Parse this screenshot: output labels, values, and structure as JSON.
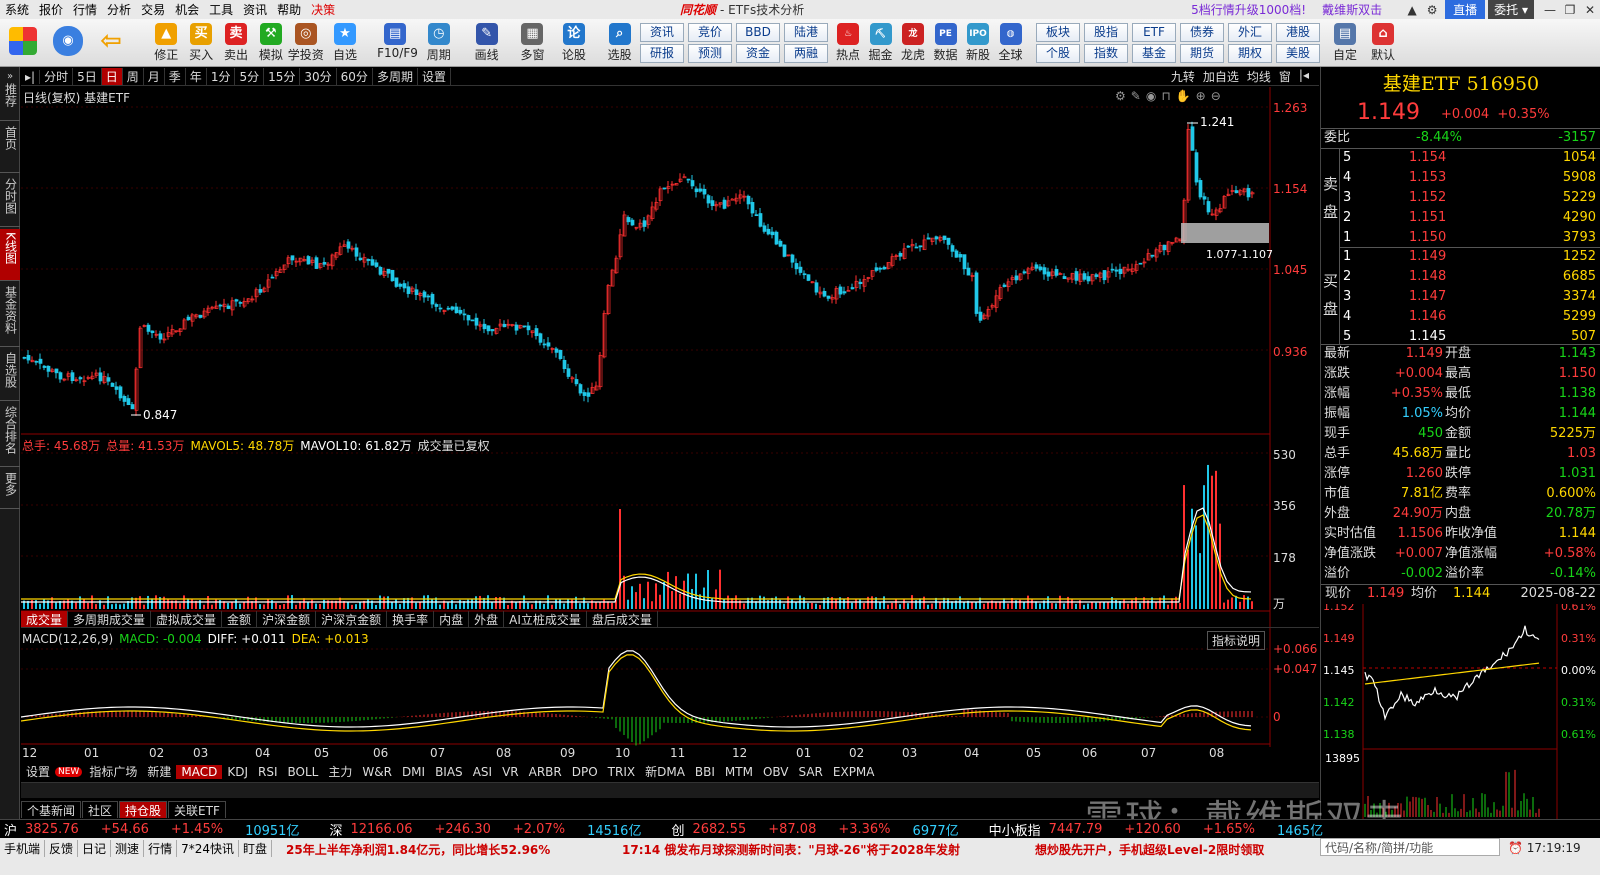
{
  "menubar": {
    "items": [
      "系统",
      "报价",
      "行情",
      "分析",
      "交易",
      "机会",
      "工具",
      "资讯",
      "帮助"
    ],
    "highlight": "决策",
    "logo": "同花顺",
    "title": "- ETFs技术分析",
    "promo": "5档行情升级1000档!",
    "user": "戴维斯双击",
    "btn_live": "直播",
    "btn_entrust": "委托"
  },
  "toolbar": {
    "buttons": [
      {
        "label": "修正",
        "icon": "up-arrow-icon"
      },
      {
        "label": "买入",
        "icon": "buy-icon"
      },
      {
        "label": "卖出",
        "icon": "sell-icon"
      },
      {
        "label": "模拟",
        "icon": "hammer-icon"
      },
      {
        "label": "学投资",
        "icon": "graduation-icon"
      },
      {
        "label": "自选",
        "icon": "star-icon"
      },
      {
        "label": "F10/F9",
        "icon": "document-icon"
      },
      {
        "label": "周期",
        "icon": "clock-icon"
      },
      {
        "label": "画线",
        "icon": "pen-icon"
      },
      {
        "label": "多窗",
        "icon": "grid-icon"
      },
      {
        "label": "论股",
        "icon": "discuss-icon"
      },
      {
        "label": "选股",
        "icon": "search-icon"
      }
    ],
    "grid1": [
      "资讯",
      "竞价",
      "BBD",
      "陆港"
    ],
    "grid2": [
      "研报",
      "预测",
      "资金",
      "两融"
    ],
    "buttons2": [
      {
        "label": "热点",
        "icon": "hot-icon"
      },
      {
        "label": "掘金",
        "icon": "dig-icon"
      },
      {
        "label": "龙虎",
        "icon": "dragon-icon"
      },
      {
        "label": "数据",
        "icon": "data-icon"
      },
      {
        "label": "新股",
        "icon": "ipo-icon"
      },
      {
        "label": "全球",
        "icon": "globe-icon"
      }
    ],
    "grid3": [
      "板块",
      "股指",
      "ETF",
      "债券",
      "外汇",
      "港股"
    ],
    "grid4": [
      "个股",
      "指数",
      "基金",
      "期货",
      "期权",
      "美股"
    ],
    "buttons3": [
      {
        "label": "自定",
        "icon": "custom-icon"
      },
      {
        "label": "默认",
        "icon": "home-icon"
      }
    ]
  },
  "leftbar": [
    "推荐",
    "首页",
    "分时图",
    "K线图",
    "基金资料",
    "自选股",
    "综合排名",
    "更多"
  ],
  "periods": {
    "items": [
      "分时",
      "5日",
      "日",
      "周",
      "月",
      "季",
      "年",
      "1分",
      "5分",
      "15分",
      "30分",
      "60分",
      "多周期",
      "设置"
    ],
    "active": "日",
    "right": [
      "九转",
      "加自选",
      "均线",
      "窗"
    ]
  },
  "kchart": {
    "title": "日线(复权) 基建ETF",
    "ticks": [
      "1.263",
      "1.154",
      "1.045",
      "0.936"
    ],
    "high_label": "1.241",
    "low_label": "0.847",
    "range_label": "1.077-1.107"
  },
  "volume": {
    "legend": [
      {
        "text": "总手: 45.68万",
        "color": "#ff3c3c"
      },
      {
        "text": "总量: 41.53万",
        "color": "#ff3c3c"
      },
      {
        "text": "MAVOL5: 48.78万",
        "color": "#ffd700"
      },
      {
        "text": "MAVOL10: 61.82万",
        "color": "#ffffff"
      },
      {
        "text": "成交量已复权",
        "color": "#dddddd"
      }
    ],
    "ticks": [
      "530",
      "356",
      "178"
    ],
    "unit": "万"
  },
  "subtabs": [
    "成交量",
    "多周期成交量",
    "虚拟成交量",
    "金额",
    "沪深金额",
    "沪深京金额",
    "换手率",
    "内盘",
    "外盘",
    "AI立桩成交量",
    "盘后成交量"
  ],
  "macd": {
    "legend": [
      {
        "text": "MACD(12,26,9)",
        "color": "#dddddd"
      },
      {
        "text": "MACD: -0.004",
        "color": "#18d418"
      },
      {
        "text": "DIFF: +0.011",
        "color": "#ffffff"
      },
      {
        "text": "DEA: +0.013",
        "color": "#ffd700"
      }
    ],
    "explain": "指标说明",
    "ticks": [
      "+0.066",
      "+0.047",
      "0"
    ]
  },
  "months": [
    "12",
    "01",
    "02",
    "03",
    "04",
    "05",
    "06",
    "07",
    "08",
    "09",
    "10",
    "11",
    "12",
    "01",
    "02",
    "03",
    "04",
    "05",
    "06",
    "07",
    "08"
  ],
  "indtabs": {
    "settings": "设置",
    "new": "NEW",
    "square": "指标广场",
    "create": "新建",
    "items": [
      "MACD",
      "KDJ",
      "RSI",
      "BOLL",
      "主力",
      "W&R",
      "DMI",
      "BIAS",
      "ASI",
      "VR",
      "ARBR",
      "DPO",
      "TRIX",
      "新DMA",
      "BBI",
      "MTM",
      "OBV",
      "SAR",
      "EXPMA"
    ]
  },
  "bottomtabs": [
    "个基新闻",
    "社区",
    "持仓股",
    "关联ETF"
  ],
  "rpanel": {
    "title": "基建ETF 516950",
    "price": "1.149",
    "change": "+0.004",
    "pct": "+0.35%",
    "weibi_label": "委比",
    "weibi_pct": "-8.44%",
    "weibi_val": "-3157",
    "sell_label": "卖盘",
    "buy_label": "买盘",
    "asks": [
      {
        "lvl": "5",
        "p": "1.154",
        "v": "1054"
      },
      {
        "lvl": "4",
        "p": "1.153",
        "v": "5908"
      },
      {
        "lvl": "3",
        "p": "1.152",
        "v": "5229"
      },
      {
        "lvl": "2",
        "p": "1.151",
        "v": "4290"
      },
      {
        "lvl": "1",
        "p": "1.150",
        "v": "3793"
      }
    ],
    "bids": [
      {
        "lvl": "1",
        "p": "1.149",
        "v": "1252"
      },
      {
        "lvl": "2",
        "p": "1.148",
        "v": "6685"
      },
      {
        "lvl": "3",
        "p": "1.147",
        "v": "3374"
      },
      {
        "lvl": "4",
        "p": "1.146",
        "v": "5299"
      },
      {
        "lvl": "5",
        "p": "1.145",
        "v": "507"
      }
    ],
    "stats": [
      {
        "l1": "最新",
        "v1": "1.149",
        "c1": "red",
        "l2": "开盘",
        "v2": "1.143",
        "c2": "green"
      },
      {
        "l1": "涨跌",
        "v1": "+0.004",
        "c1": "red",
        "l2": "最高",
        "v2": "1.150",
        "c2": "red"
      },
      {
        "l1": "涨幅",
        "v1": "+0.35%",
        "c1": "red",
        "l2": "最低",
        "v2": "1.138",
        "c2": "green"
      },
      {
        "l1": "振幅",
        "v1": "1.05%",
        "c1": "cyan",
        "l2": "均价",
        "v2": "1.144",
        "c2": "green"
      },
      {
        "l1": "现手",
        "v1": "450",
        "c1": "green",
        "l2": "金额",
        "v2": "5225万",
        "c2": "yellow"
      },
      {
        "l1": "总手",
        "v1": "45.68万",
        "c1": "yellow",
        "l2": "量比",
        "v2": "1.03",
        "c2": "red"
      },
      {
        "l1": "涨停",
        "v1": "1.260",
        "c1": "red",
        "l2": "跌停",
        "v2": "1.031",
        "c2": "green"
      },
      {
        "l1": "市值",
        "v1": "7.81亿",
        "c1": "yellow",
        "l2": "费率",
        "v2": "0.600%",
        "c2": "yellow"
      },
      {
        "l1": "外盘",
        "v1": "24.90万",
        "c1": "red",
        "l2": "内盘",
        "v2": "20.78万",
        "c2": "green"
      },
      {
        "l1": "实时估值",
        "v1": "1.1506",
        "c1": "red",
        "l2": "昨收净值",
        "v2": "1.144",
        "c2": "yellow"
      },
      {
        "l1": "净值涨跌",
        "v1": "+0.007",
        "c1": "red",
        "l2": "净值涨幅",
        "v2": "+0.58%",
        "c2": "red"
      },
      {
        "l1": "溢价",
        "v1": "-0.002",
        "c1": "green",
        "l2": "溢价率",
        "v2": "-0.14%",
        "c2": "green"
      }
    ],
    "mini": {
      "now_label": "现价",
      "now": "1.149",
      "avg_label": "均价",
      "avg": "1.144",
      "date": "2025-08-22",
      "left_ticks": [
        "1.152",
        "1.149",
        "1.145",
        "1.142",
        "1.138"
      ],
      "right_ticks": [
        "0.61%",
        "0.31%",
        "0.00%",
        "0.31%",
        "0.61%"
      ],
      "vol_tick": "13895"
    }
  },
  "ticker": {
    "items": [
      {
        "t": "沪",
        "c": "white"
      },
      {
        "t": "3825.76",
        "c": "red"
      },
      {
        "t": "+54.66",
        "c": "red"
      },
      {
        "t": "+1.45%",
        "c": "red"
      },
      {
        "t": "10951亿",
        "c": "cyan"
      },
      {
        "t": "深",
        "c": "white"
      },
      {
        "t": "12166.06",
        "c": "red"
      },
      {
        "t": "+246.30",
        "c": "red"
      },
      {
        "t": "+2.07%",
        "c": "red"
      },
      {
        "t": "14516亿",
        "c": "cyan"
      },
      {
        "t": "创",
        "c": "white"
      },
      {
        "t": "2682.55",
        "c": "red"
      },
      {
        "t": "+87.08",
        "c": "red"
      },
      {
        "t": "+3.36%",
        "c": "red"
      },
      {
        "t": "6977亿",
        "c": "cyan"
      },
      {
        "t": "中小板指",
        "c": "white"
      },
      {
        "t": "7447.79",
        "c": "red"
      },
      {
        "t": "+120.60",
        "c": "red"
      },
      {
        "t": "+1.65%",
        "c": "red"
      },
      {
        "t": "1465亿",
        "c": "cyan"
      }
    ]
  },
  "statusbar": {
    "items": [
      "手机端",
      "反馈",
      "日记",
      "测速",
      "行情",
      "7*24快讯",
      "盯盘"
    ],
    "news1": "25年上半年净利润1.84亿元，同比增长52.96%",
    "news2": "17:14 俄发布月球探测新时间表：\"月球-26\"将于2028年发射",
    "news3": "想炒股先开户，手机超级Level-2限时领取",
    "search": "代码/名称/简拼/功能",
    "time": "17:19:19"
  },
  "watermark": "雪球：戴维斯双击"
}
